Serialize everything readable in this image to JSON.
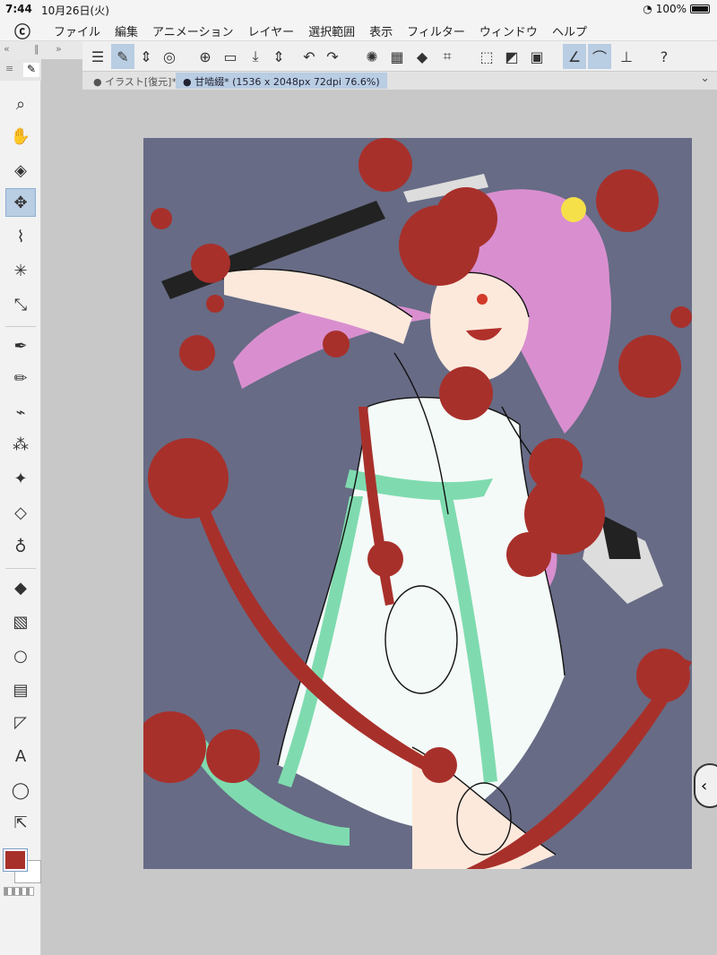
{
  "status": {
    "time": "7:44",
    "date": "10月26日(火)",
    "battery": "100%"
  },
  "menu": {
    "logo": "ⓒ",
    "items": [
      "ファイル",
      "編集",
      "アニメーション",
      "レイヤー",
      "選択範囲",
      "表示",
      "フィルター",
      "ウィンドウ",
      "ヘルプ"
    ]
  },
  "tabs": [
    {
      "label": "● イラスト[復元]*"
    },
    {
      "label": "● 甘啮綴* (1536 x 2048px 72dpi 76.6%)"
    }
  ],
  "colors": {
    "main": "#a8302b",
    "canvas_bg": "#676b85",
    "accent": "#b9cde3"
  },
  "tools": [
    "zoom-icon",
    "hand-icon",
    "layer-move-icon",
    "move-icon",
    "lasso-icon",
    "magic-wand-icon",
    "eyedropper-icon",
    "pen-icon",
    "pencil-icon",
    "brush-icon",
    "airbrush-icon",
    "decoration-icon",
    "eraser-icon",
    "blend-icon",
    "fill-icon",
    "gradient-icon",
    "figure-icon",
    "frame-icon",
    "ruler-icon",
    "text-icon",
    "balloon-icon",
    "object-icon"
  ]
}
